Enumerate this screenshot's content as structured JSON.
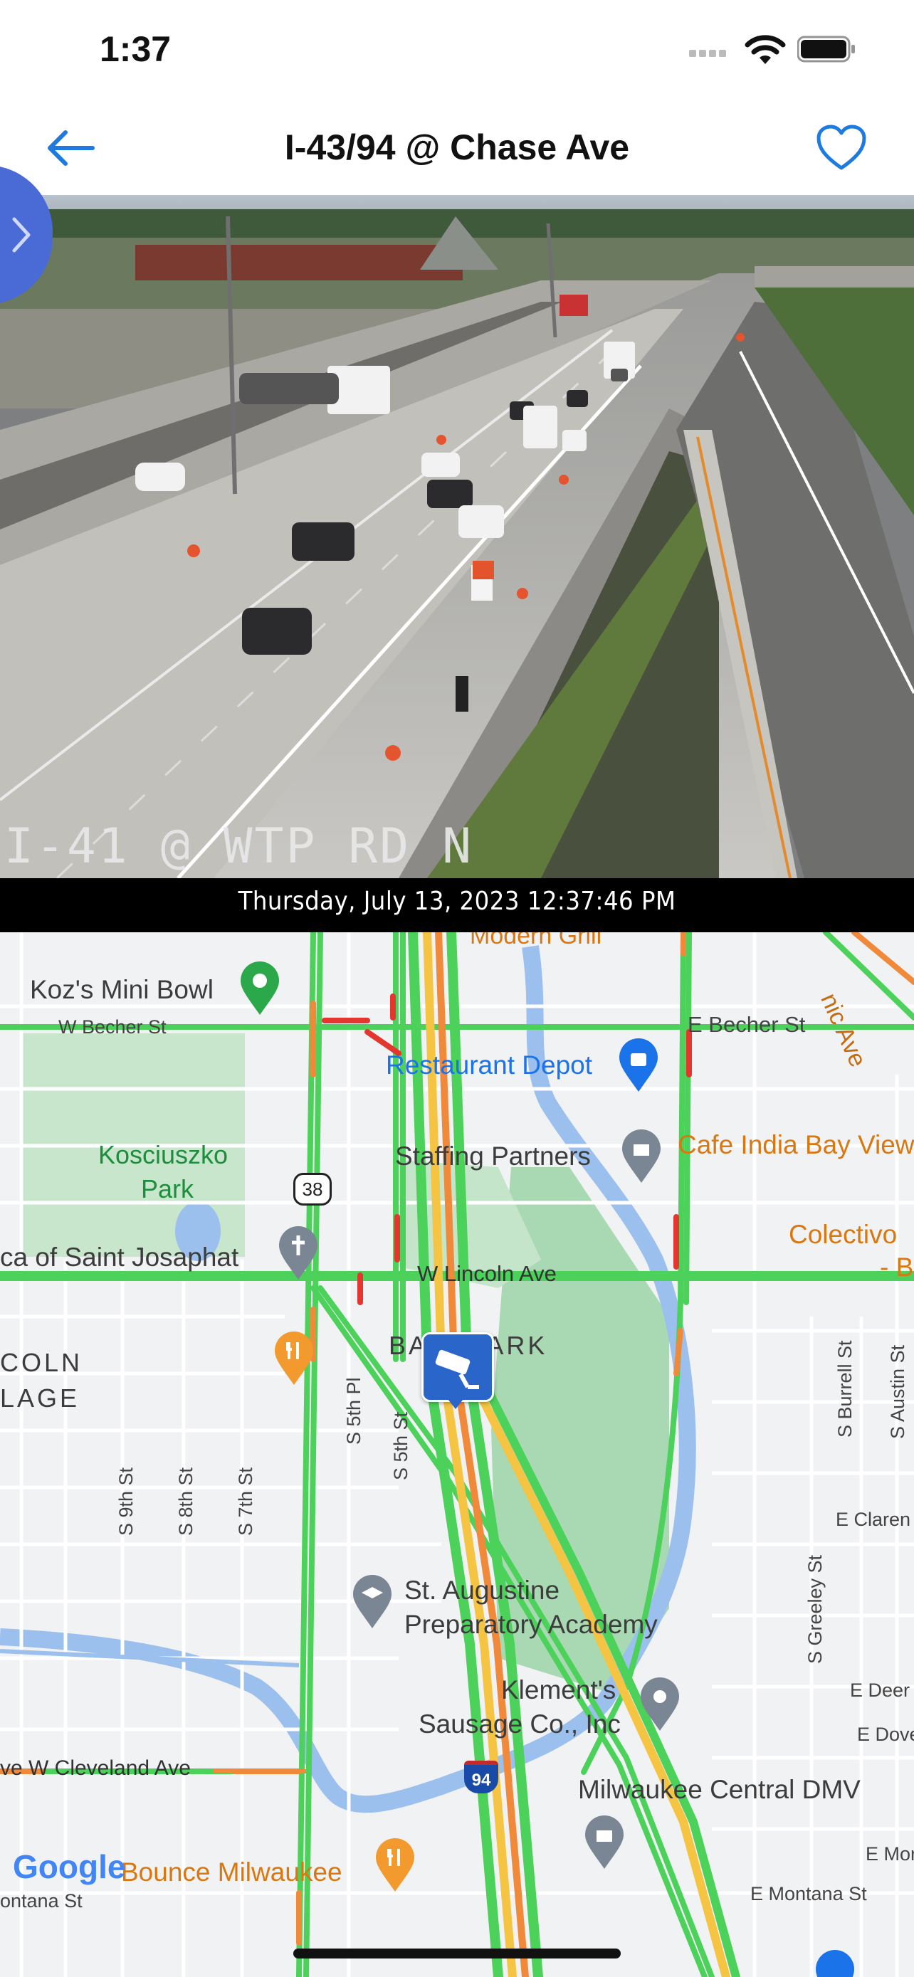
{
  "status_bar": {
    "time": "1:37"
  },
  "nav": {
    "title": "I-43/94 @ Chase Ave"
  },
  "camera": {
    "overlay_label": "I-41 @ WTP RD  N",
    "timestamp": "Thursday, July 13, 2023 12:37:46 PM"
  },
  "map": {
    "streets": {
      "w_becher": "W Becher St",
      "e_becher": "E Becher St",
      "w_lincoln": "W Lincoln Ave",
      "w_cleveland": "ve W Cleveland Ave",
      "e_montana": "E Montana St",
      "w_montana": "ontana St",
      "s_9th": "S 9th St",
      "s_8th": "S 8th St",
      "s_7th": "S 7th St",
      "s_5th_pl": "S 5th Pl",
      "s_5th": "S 5th St",
      "s_greeley": "S Greeley St",
      "s_burrell": "S Burrell St",
      "s_austin": "S Austin St",
      "e_clarence": "E Claren",
      "e_deer": "E Deer",
      "e_dover": "E Dover",
      "e_mor": "E Mor",
      "scenic_ave": "nic Ave"
    },
    "places": {
      "kozs": "Koz's Mini Bowl",
      "modern_grill": "Modern Grill",
      "restaurant_depot": "Restaurant Depot",
      "staffing_partners": "Staffing Partners",
      "cafe_india": "Cafe India Bay View",
      "kosciuszko_1": "Kosciuszko",
      "kosciuszko_2": "Park",
      "basilica": "ca of Saint Josaphat",
      "colectivo_1": "Colectivo",
      "colectivo_2": "- Ba",
      "lincoln_village_1": "COLN",
      "lincoln_village_2": "LAGE",
      "bay_park": "BA    N PARK",
      "st_augustine_1": "St. Augustine",
      "st_augustine_2": "Preparatory Academy",
      "klements_1": "Klement's",
      "klements_2": "Sausage Co., Inc",
      "dmv": "Milwaukee Central DMV",
      "bounce": "Bounce Milwaukee"
    },
    "shields": {
      "route38": "38",
      "i94": "94"
    },
    "attribution": "Google"
  },
  "colors": {
    "accent": "#1f7ae0",
    "traffic_green": "#4cd15a",
    "traffic_orange": "#f08a3a",
    "traffic_red": "#e2362f",
    "camera_marker": "#2a66c9"
  },
  "icons": [
    "back-arrow-icon",
    "heart-icon",
    "chevron-right-icon",
    "wifi-icon",
    "battery-icon",
    "traffic-camera-icon",
    "map-pin-icon",
    "shopping-bag-icon",
    "building-icon",
    "church-icon",
    "restaurant-icon",
    "school-icon",
    "location-pin-icon"
  ]
}
